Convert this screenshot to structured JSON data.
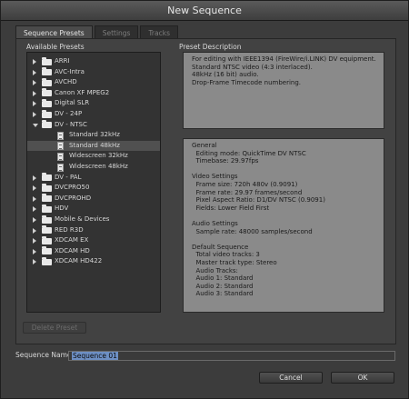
{
  "window": {
    "title": "New Sequence"
  },
  "tabs": [
    {
      "label": "Sequence Presets",
      "active": true
    },
    {
      "label": "Settings",
      "active": false
    },
    {
      "label": "Tracks",
      "active": false
    }
  ],
  "presets": {
    "header": "Available Presets",
    "items": [
      {
        "label": "ARRI",
        "kind": "folder",
        "expanded": false,
        "depth": 0,
        "selected": false
      },
      {
        "label": "AVC-Intra",
        "kind": "folder",
        "expanded": false,
        "depth": 0,
        "selected": false
      },
      {
        "label": "AVCHD",
        "kind": "folder",
        "expanded": false,
        "depth": 0,
        "selected": false
      },
      {
        "label": "Canon XF MPEG2",
        "kind": "folder",
        "expanded": false,
        "depth": 0,
        "selected": false
      },
      {
        "label": "Digital SLR",
        "kind": "folder",
        "expanded": false,
        "depth": 0,
        "selected": false
      },
      {
        "label": "DV - 24P",
        "kind": "folder",
        "expanded": false,
        "depth": 0,
        "selected": false
      },
      {
        "label": "DV - NTSC",
        "kind": "folder",
        "expanded": true,
        "depth": 0,
        "selected": false
      },
      {
        "label": "Standard 32kHz",
        "kind": "file",
        "depth": 1,
        "selected": false
      },
      {
        "label": "Standard 48kHz",
        "kind": "file",
        "depth": 1,
        "selected": true
      },
      {
        "label": "Widescreen 32kHz",
        "kind": "file",
        "depth": 1,
        "selected": false
      },
      {
        "label": "Widescreen 48kHz",
        "kind": "file",
        "depth": 1,
        "selected": false
      },
      {
        "label": "DV - PAL",
        "kind": "folder",
        "expanded": false,
        "depth": 0,
        "selected": false
      },
      {
        "label": "DVCPRO50",
        "kind": "folder",
        "expanded": false,
        "depth": 0,
        "selected": false
      },
      {
        "label": "DVCPROHD",
        "kind": "folder",
        "expanded": false,
        "depth": 0,
        "selected": false
      },
      {
        "label": "HDV",
        "kind": "folder",
        "expanded": false,
        "depth": 0,
        "selected": false
      },
      {
        "label": "Mobile & Devices",
        "kind": "folder",
        "expanded": false,
        "depth": 0,
        "selected": false
      },
      {
        "label": "RED R3D",
        "kind": "folder",
        "expanded": false,
        "depth": 0,
        "selected": false
      },
      {
        "label": "XDCAM EX",
        "kind": "folder",
        "expanded": false,
        "depth": 0,
        "selected": false
      },
      {
        "label": "XDCAM HD",
        "kind": "folder",
        "expanded": false,
        "depth": 0,
        "selected": false
      },
      {
        "label": "XDCAM HD422",
        "kind": "folder",
        "expanded": false,
        "depth": 0,
        "selected": false
      }
    ]
  },
  "description": {
    "header": "Preset Description",
    "summary": "For editing with IEEE1394 (FireWire/i.LINK) DV equipment.\nStandard NTSC video (4:3 interlaced).\n48kHz (16 bit) audio.\nDrop-Frame Timecode numbering.",
    "details": "General\n  Editing mode: QuickTime DV NTSC\n  Timebase: 29.97fps\n\nVideo Settings\n  Frame size: 720h 480v (0.9091)\n  Frame rate: 29.97 frames/second\n  Pixel Aspect Ratio: D1/DV NTSC (0.9091)\n  Fields: Lower Field First\n\nAudio Settings\n  Sample rate: 48000 samples/second\n\nDefault Sequence\n  Total video tracks: 3\n  Master track type: Stereo\n  Audio Tracks:\n  Audio 1: Standard\n  Audio 2: Standard\n  Audio 3: Standard"
  },
  "buttons": {
    "delete_preset": "Delete Preset",
    "cancel": "Cancel",
    "ok": "OK"
  },
  "sequence_name": {
    "label": "Sequence Name:",
    "value": "Sequence 01"
  }
}
